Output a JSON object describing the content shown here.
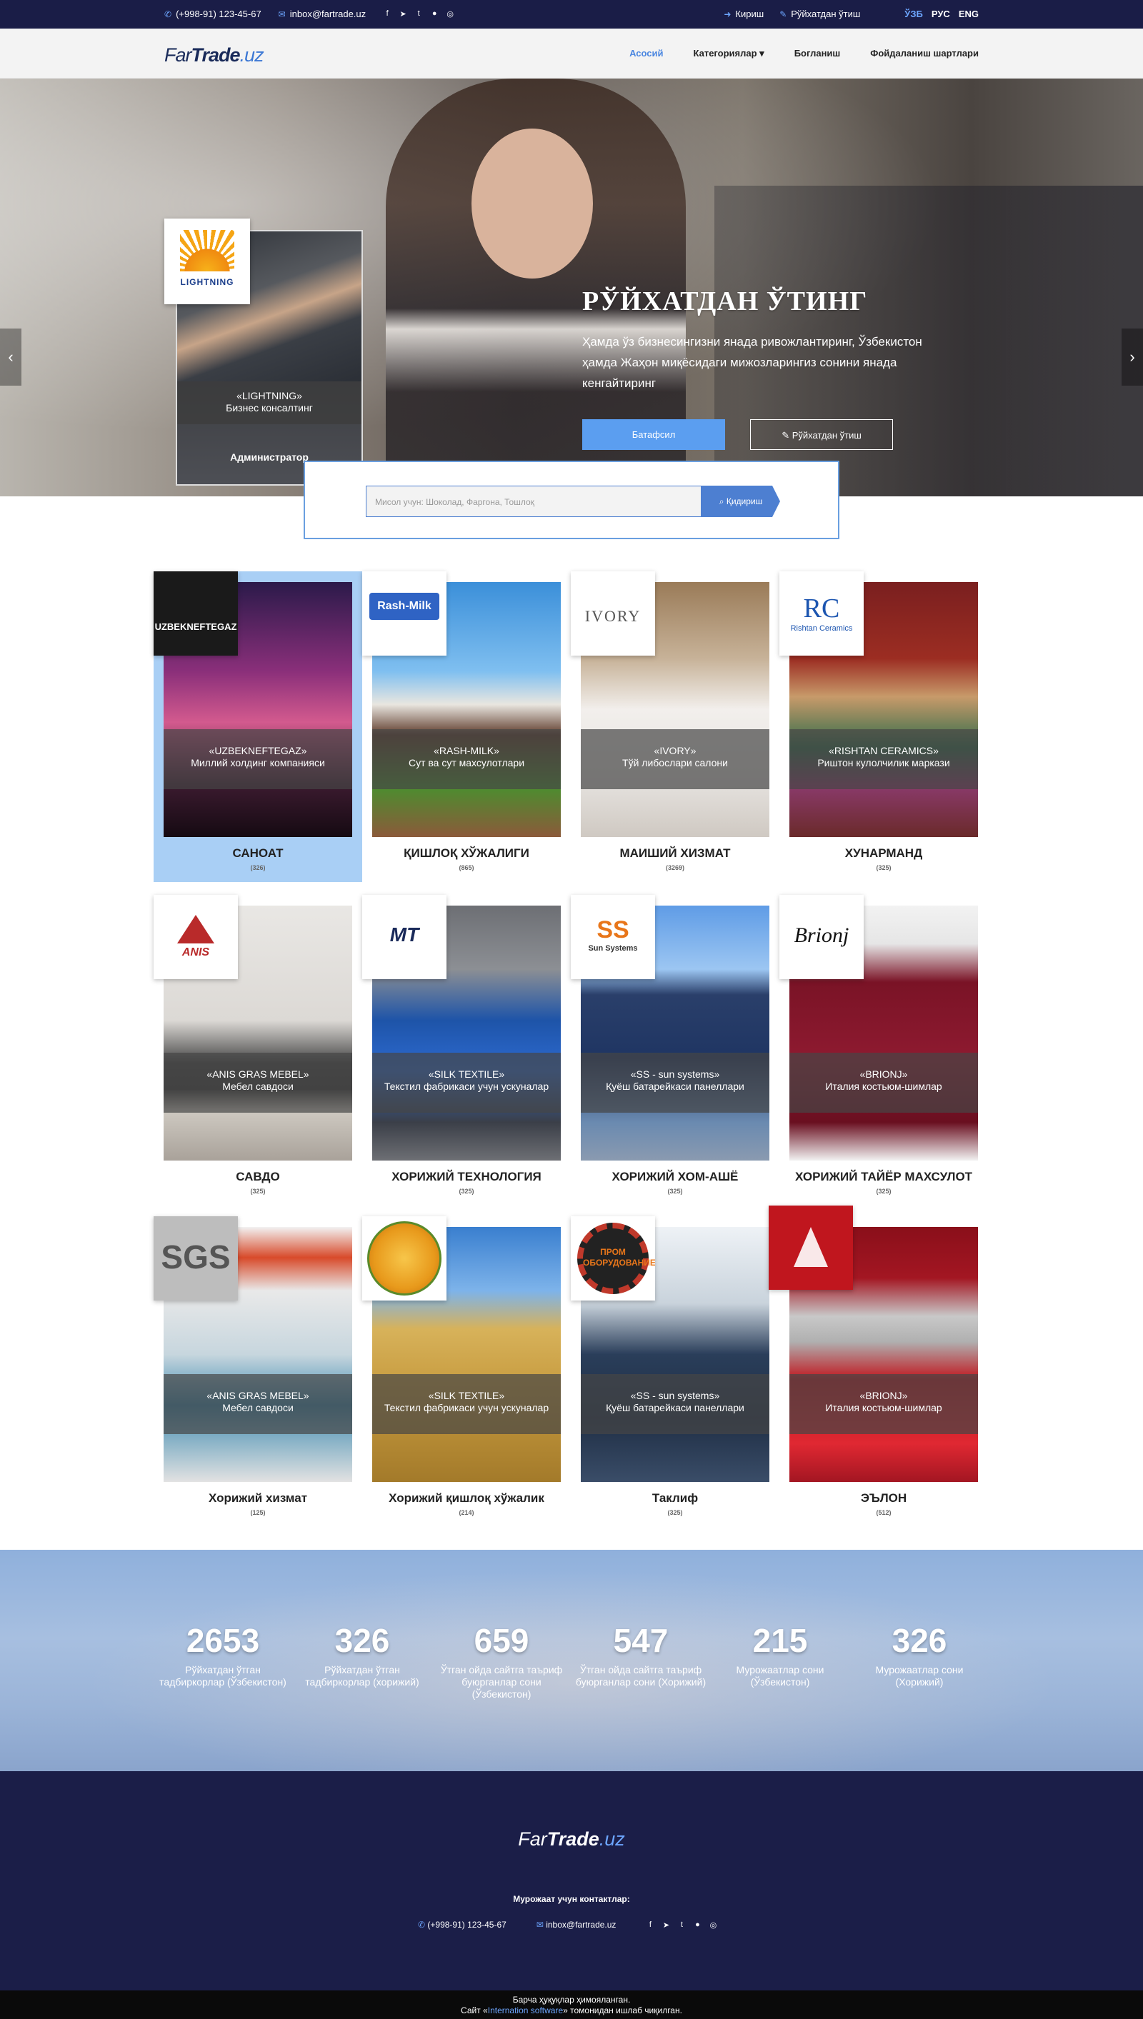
{
  "topbar": {
    "phone": "(+998-91) 123-45-67",
    "email": "inbox@fartrade.uz",
    "login": "Кириш",
    "register": "Рўйхатдан ўтиш",
    "languages": [
      "ЎЗБ",
      "РУС",
      "ENG"
    ],
    "active_language": "ЎЗБ"
  },
  "header": {
    "logo_far": "Far",
    "logo_trade": "Trade",
    "logo_uz": ".uz",
    "nav": [
      "Асосий",
      "Категориялар ▾",
      "Богланиш",
      "Фойдаланиш шартлари"
    ]
  },
  "hero": {
    "card_caption_1": "«LIGHTNING»",
    "card_caption_2": "Бизнес консалтинг",
    "card_role": "Администратор",
    "card_logo_text": "LIGHTNING",
    "title": "РЎЙХАТДАН ЎТИНГ",
    "text": "Ҳамда ўз бизнесингизни янада ривожлантиринг, Ўзбекистон ҳамда Жаҳон миқёсидаги мижозларингиз сонини янада кенгайтиринг",
    "btn_more": "Батафсил",
    "btn_register": "Рўйхатдан ўтиш"
  },
  "search": {
    "placeholder": "Мисол учун: Шоколад, Фаргона, Тошлоқ",
    "button": "Қидириш"
  },
  "categories": [
    {
      "logo": "UZBEKNEFTEGAZ",
      "company": "«UZBEKNEFTEGAZ»",
      "desc": "Миллий холдинг компанияси",
      "title": "САНОАТ",
      "count": "(326)"
    },
    {
      "logo": "Rash-Milk",
      "company": "«RASH-MILK»",
      "desc": "Сут ва сут махсулотлари",
      "title": "ҚИШЛОҚ ХЎЖАЛИГИ",
      "count": "(865)"
    },
    {
      "logo": "IVORY",
      "company": "«IVORY»",
      "desc": "Тўй либослари салони",
      "title": "МАИШИЙ ХИЗМАТ",
      "count": "(3269)"
    },
    {
      "logo": "RC",
      "logo_sub": "Rishtan Ceramics",
      "company": "«RISHTAN CERAMICS»",
      "desc": "Риштон кулолчилик маркази",
      "title": "ХУНАРМАНД",
      "count": "(325)"
    },
    {
      "logo": "ANIS",
      "company": "«ANIS GRAS MEBEL»",
      "desc": "Мебел савдоси",
      "title": "САВДО",
      "count": "(325)"
    },
    {
      "logo": "MT",
      "company": "«SILK TEXTILE»",
      "desc": "Текстил фабрикаси учун ускуналар",
      "title": "ХОРИЖИЙ ТЕХНОЛОГИЯ",
      "count": "(325)"
    },
    {
      "logo": "SS",
      "logo_sub": "Sun Systems",
      "company": "«SS - sun systems»",
      "desc": "Қуёш батарейкаси панеллари",
      "title": "ХОРИЖИЙ ХОМ-АШЁ",
      "count": "(325)"
    },
    {
      "logo": "Brionj",
      "company": "«BRIONJ»",
      "desc": "Италия костьюм-шимлар",
      "title": "ХОРИЖИЙ ТАЙЁР МАХСУЛОТ",
      "count": "(325)"
    },
    {
      "logo": "SGS",
      "company": "«ANIS GRAS MEBEL»",
      "desc": "Мебел савдоси",
      "title": "Хорижий хизмат",
      "count": "(125)"
    },
    {
      "logo": "",
      "company": "«SILK TEXTILE»",
      "desc": "Текстил фабрикаси учун ускуналар",
      "title": "Хорижий қишлоқ хўжалик",
      "count": "(214)"
    },
    {
      "logo": "ПРОМ ОБОРУДОВАНИЕ",
      "company": "«SS - sun systems»",
      "desc": "Қуёш батарейкаси панеллари",
      "title": "Таклиф",
      "count": "(325)"
    },
    {
      "logo": "",
      "company": "«BRIONJ»",
      "desc": "Италия костьюм-шимлар",
      "title": "ЭЪЛОН",
      "count": "(512)"
    }
  ],
  "stats": [
    {
      "num": "2653",
      "label": "Рўйхатдан ўтган тадбиркорлар (Ўзбекистон)"
    },
    {
      "num": "326",
      "label": "Рўйхатдан ўтган тадбиркорлар (хорижий)"
    },
    {
      "num": "659",
      "label": "Ўтган ойда сайтга таъриф буюрганлар сони (Ўзбекистон)"
    },
    {
      "num": "547",
      "label": "Ўтган ойда сайтга таъриф буюрганлар сони (Хорижий)"
    },
    {
      "num": "215",
      "label": "Мурожаатлар сони (Ўзбекистон)"
    },
    {
      "num": "326",
      "label": "Мурожаатлар сони (Хорижий)"
    }
  ],
  "footer": {
    "logo_far": "Far",
    "logo_trade": "Trade",
    "logo_uz": ".uz",
    "contact_title": "Мурожаат учун контактлар:",
    "phone": "(+998-91) 123-45-67",
    "email": "inbox@fartrade.uz",
    "rights": "Барча ҳуқуқлар ҳимояланган.",
    "made_by_prefix": "Сайт «",
    "made_by_name": "Internation software",
    "made_by_suffix": "» томонидан ишлаб чиқилган."
  },
  "colors": {
    "topbar_bg": "#1a1d47",
    "accent": "#4a86e0",
    "selected_card": "#a9cff5",
    "footer_bg": "#1b1e48"
  }
}
